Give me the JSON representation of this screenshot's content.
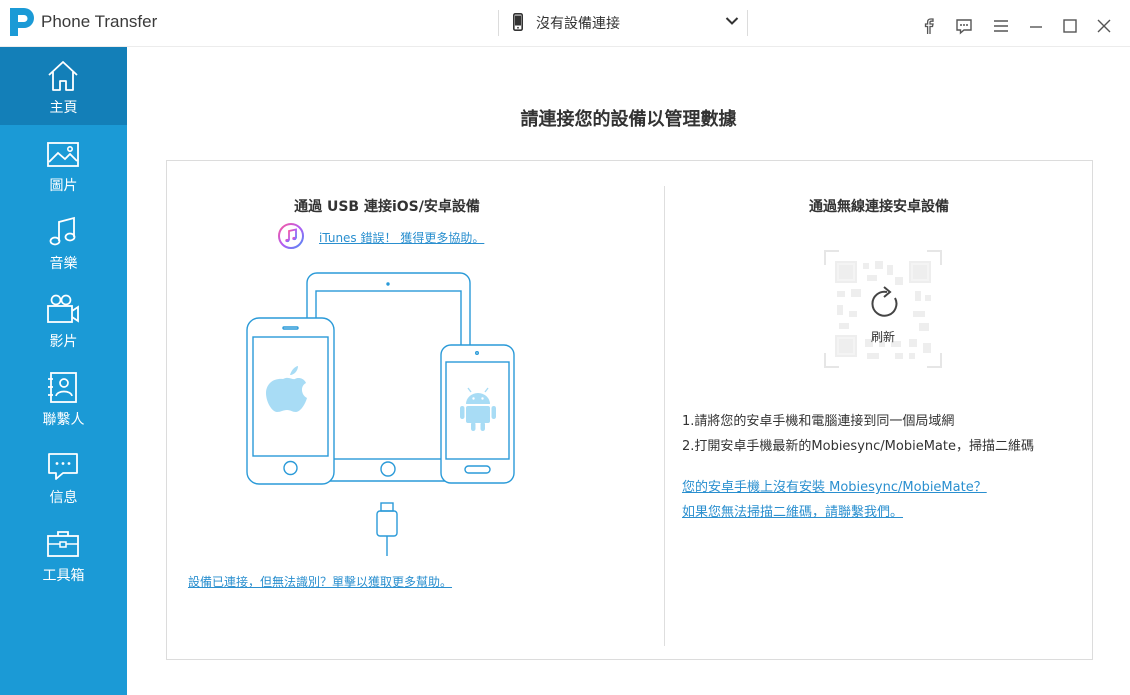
{
  "app": {
    "title": "Phone Transfer"
  },
  "device_selector": {
    "label": "沒有設備連接"
  },
  "window_controls": [
    "facebook-icon",
    "feedback-icon",
    "menu-icon",
    "minimize-icon",
    "maximize-icon",
    "close-icon"
  ],
  "sidebar": {
    "items": [
      {
        "label": "主頁",
        "icon": "home-icon",
        "active": true
      },
      {
        "label": "圖片",
        "icon": "photo-icon"
      },
      {
        "label": "音樂",
        "icon": "music-icon"
      },
      {
        "label": "影片",
        "icon": "video-icon"
      },
      {
        "label": "聯繫人",
        "icon": "contacts-icon"
      },
      {
        "label": "信息",
        "icon": "message-icon"
      },
      {
        "label": "工具箱",
        "icon": "toolbox-icon"
      }
    ]
  },
  "main": {
    "title": "請連接您的設備以管理數據",
    "usb": {
      "title": "通過 USB 連接iOS/安卓設備",
      "itunes_link": "iTunes 錯誤！ 獲得更多協助。",
      "help_link": "設備已連接，但無法識別？單擊以獲取更多幫助。"
    },
    "wireless": {
      "title": "通過無線連接安卓設備",
      "refresh_label": "刷新",
      "steps": [
        "1.請將您的安卓手機和電腦連接到同一個局域網",
        "2.打開安卓手機最新的Mobiesync/MobieMate，掃描二維碼"
      ],
      "links": [
        "您的安卓手機上沒有安裝 Mobiesync/MobieMate？",
        "如果您無法掃描二維碼，請聯繫我們。"
      ]
    }
  },
  "colors": {
    "sidebar": "#1b9ad6",
    "sidebar_active": "#137fb8",
    "link": "#2a8fcf",
    "device_line": "#2a9ad8"
  }
}
